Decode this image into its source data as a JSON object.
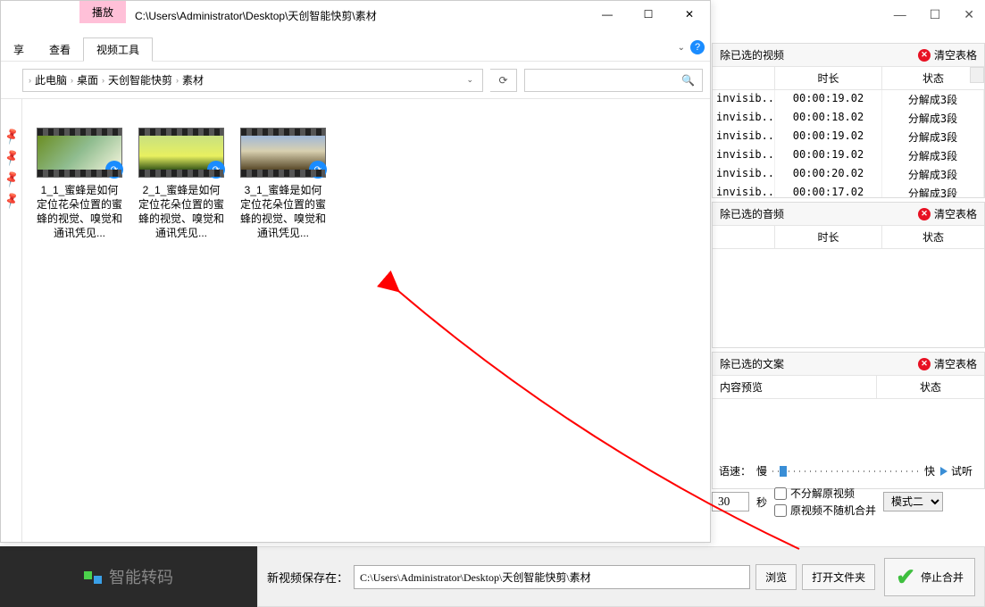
{
  "bgWindow": {
    "min": "—",
    "max": "☐",
    "close": "✕"
  },
  "explorer": {
    "playTab": "播放",
    "path": "C:\\Users\\Administrator\\Desktop\\天创智能快剪\\素材",
    "winMin": "—",
    "winMax": "☐",
    "winClose": "✕",
    "tabShare": "享",
    "tabView": "查看",
    "tabVideo": "视频工具",
    "chevron": "⌄",
    "help": "?",
    "crumbs": [
      "此电脑",
      "桌面",
      "天创智能快剪",
      "素材"
    ],
    "refresh": "⟳",
    "searchIcon": "🔍",
    "files": [
      {
        "name": "1_1_蜜蜂是如何定位花朵位置的蜜蜂的视觉、嗅觉和通讯凭见..."
      },
      {
        "name": "2_1_蜜蜂是如何定位花朵位置的蜜蜂的视觉、嗅觉和通讯凭见..."
      },
      {
        "name": "3_1_蜜蜂是如何定位花朵位置的蜜蜂的视觉、嗅觉和通讯凭见..."
      }
    ]
  },
  "panels": {
    "video": {
      "title": "除已选的视频",
      "clear": "清空表格",
      "cols": {
        "dur": "时长",
        "state": "状态"
      },
      "rows": [
        {
          "f": "invisib..",
          "d": "00:00:19.02",
          "s": "分解成3段"
        },
        {
          "f": "invisib..",
          "d": "00:00:18.02",
          "s": "分解成3段"
        },
        {
          "f": "invisib..",
          "d": "00:00:19.02",
          "s": "分解成3段"
        },
        {
          "f": "invisib..",
          "d": "00:00:19.02",
          "s": "分解成3段"
        },
        {
          "f": "invisib..",
          "d": "00:00:20.02",
          "s": "分解成3段"
        },
        {
          "f": "invisib..",
          "d": "00:00:17.02",
          "s": "分解成3段"
        }
      ]
    },
    "audio": {
      "title": "除已选的音频",
      "clear": "清空表格",
      "cols": {
        "dur": "时长",
        "state": "状态"
      }
    },
    "text": {
      "title": "除已选的文案",
      "clear": "清空表格",
      "cols": {
        "prev": "内容预览",
        "state": "状态"
      }
    }
  },
  "speed": {
    "label": "语速：",
    "slow": "慢",
    "fast": "快",
    "try": "试听"
  },
  "opts": {
    "sec": "30",
    "secUnit": "秒",
    "noSplit": "不分解原视频",
    "noRandom": "原视频不随机合并",
    "mode": "模式二"
  },
  "bottom": {
    "transcode": "智能转码",
    "saveLabel": "新视频保存在：",
    "savePath": "C:\\Users\\Administrator\\Desktop\\天创智能快剪\\素材",
    "browse": "浏览",
    "openFolder": "打开文件夹",
    "stop": "停止合并"
  }
}
